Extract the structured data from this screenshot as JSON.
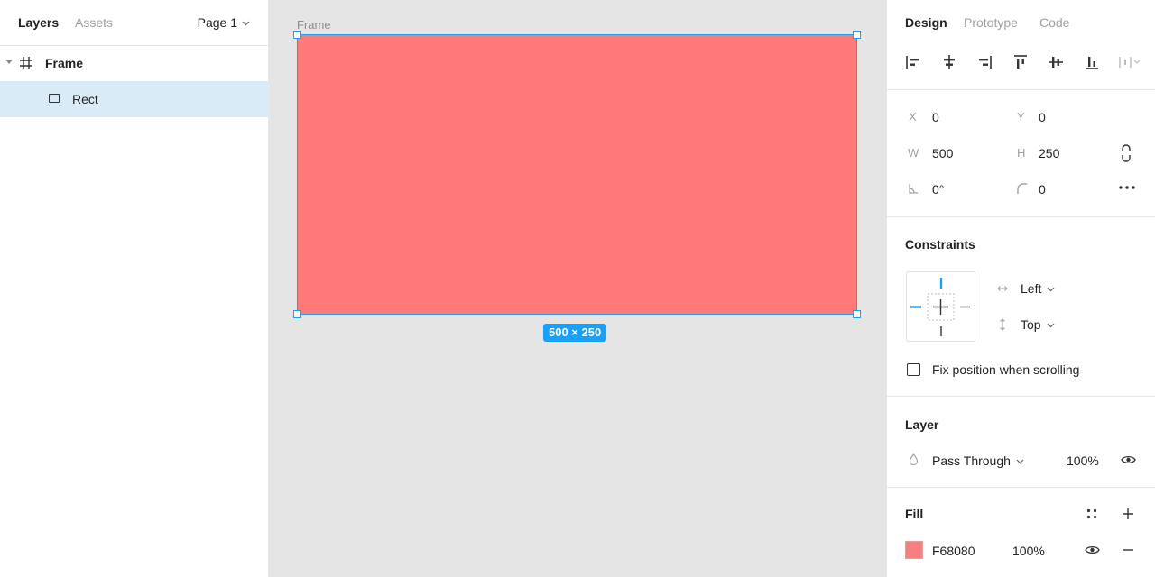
{
  "left_panel": {
    "tabs": [
      "Layers",
      "Assets"
    ],
    "page_selector": "Page 1",
    "layers": [
      {
        "label": "Frame",
        "type": "frame",
        "expanded": true
      },
      {
        "label": "Rect",
        "type": "rectangle",
        "selected": true
      }
    ]
  },
  "canvas": {
    "frame_name": "Frame",
    "frame_fill": "#ff7979",
    "selection_color": "#1ea0f2",
    "size_badge": "500 × 250"
  },
  "right_panel": {
    "tabs": [
      "Design",
      "Prototype",
      "Code"
    ],
    "alignment_icons": [
      "align-left-icon",
      "align-horizontal-center-icon",
      "align-right-icon",
      "align-top-icon",
      "align-vertical-center-icon",
      "align-bottom-icon",
      "distribute-icon"
    ],
    "position": {
      "x_label": "X",
      "x_value": "0",
      "y_label": "Y",
      "y_value": "0",
      "w_label": "W",
      "w_value": "500",
      "h_label": "H",
      "h_value": "250",
      "rotation_value": "0°",
      "radius_value": "0"
    },
    "constraints": {
      "title": "Constraints",
      "horizontal": "Left",
      "vertical": "Top",
      "fix_position_label": "Fix position when scrolling"
    },
    "layer": {
      "title": "Layer",
      "blend_mode": "Pass Through",
      "opacity": "100%"
    },
    "fill": {
      "title": "Fill",
      "color_hex": "F68080",
      "color": "#f68080",
      "opacity": "100%"
    }
  }
}
